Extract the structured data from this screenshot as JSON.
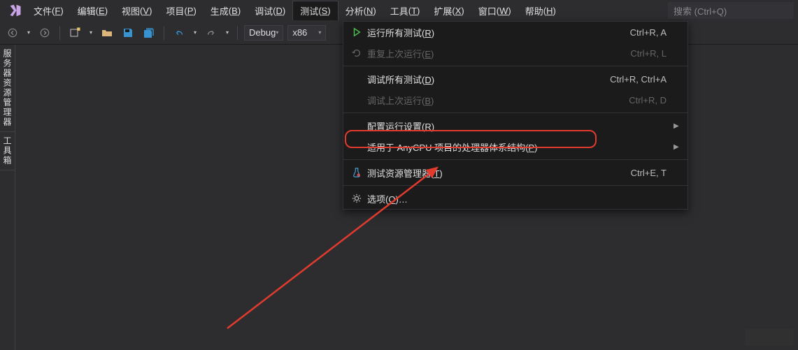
{
  "menubar": {
    "items": [
      {
        "label": "文件",
        "mn": "F"
      },
      {
        "label": "编辑",
        "mn": "E"
      },
      {
        "label": "视图",
        "mn": "V"
      },
      {
        "label": "项目",
        "mn": "P"
      },
      {
        "label": "生成",
        "mn": "B"
      },
      {
        "label": "调试",
        "mn": "D"
      },
      {
        "label": "测试",
        "mn": "S",
        "active": true
      },
      {
        "label": "分析",
        "mn": "N"
      },
      {
        "label": "工具",
        "mn": "T"
      },
      {
        "label": "扩展",
        "mn": "X"
      },
      {
        "label": "窗口",
        "mn": "W"
      },
      {
        "label": "帮助",
        "mn": "H"
      }
    ]
  },
  "search": {
    "placeholder": "搜索 (Ctrl+Q)"
  },
  "toolbar": {
    "config_label": "Debug",
    "platform_label": "x86"
  },
  "side": {
    "tabs": [
      {
        "label": "服务器资源管理器"
      },
      {
        "label": "工具箱"
      }
    ]
  },
  "dropdown": {
    "items": [
      {
        "icon": "play-outline",
        "label": "运行所有测试",
        "mn": "R",
        "shortcut": "Ctrl+R, A"
      },
      {
        "icon": "repeat",
        "label": "重复上次运行",
        "mn": "E",
        "shortcut": "Ctrl+R, L",
        "disabled": true
      },
      {
        "sep": true
      },
      {
        "icon": "",
        "label": "调试所有测试",
        "mn": "D",
        "shortcut": "Ctrl+R, Ctrl+A"
      },
      {
        "icon": "",
        "label": "调试上次运行",
        "mn": "B",
        "shortcut": "Ctrl+R, D",
        "disabled": true
      },
      {
        "sep": true
      },
      {
        "icon": "",
        "label": "配置运行设置",
        "mn": "R",
        "sub": true
      },
      {
        "icon": "",
        "label": "适用于 AnyCPU 项目的处理器体系结构",
        "mn": "P",
        "sub": true,
        "highlight": true
      },
      {
        "sep": true
      },
      {
        "icon": "beaker",
        "label": "测试资源管理器",
        "mn": "T",
        "shortcut": "Ctrl+E, T"
      },
      {
        "sep": true
      },
      {
        "icon": "gear",
        "label": "选项",
        "mn": "O",
        "extra": "…"
      }
    ]
  }
}
